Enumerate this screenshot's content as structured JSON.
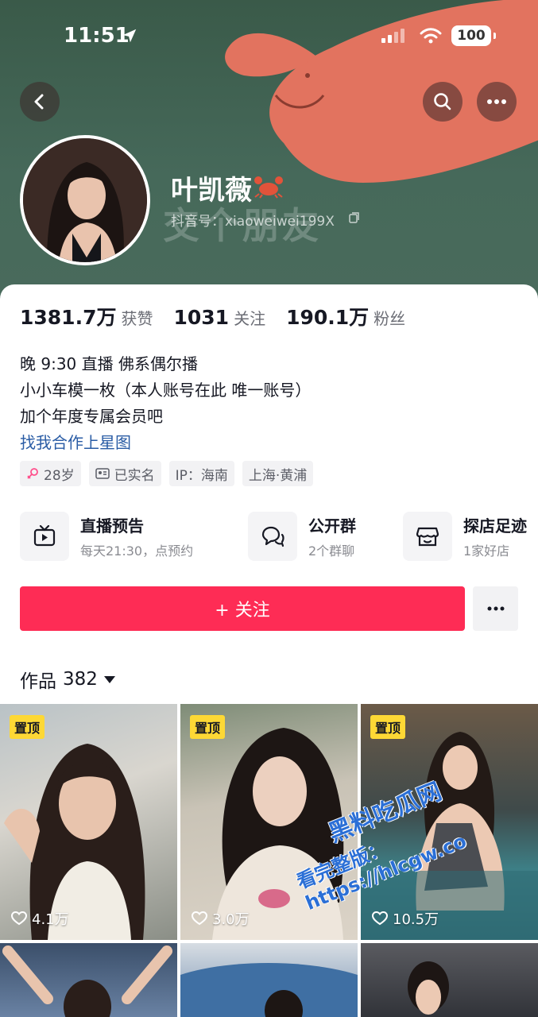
{
  "status_bar": {
    "time": "11:51",
    "battery": "100"
  },
  "profile": {
    "name": "叶凯薇",
    "douyin_id": "抖音号：xiaoweiwei199X",
    "cover_watermark": "交个朋友"
  },
  "stats": [
    {
      "value": "1381.7万",
      "label": "获赞"
    },
    {
      "value": "1031",
      "label": "关注"
    },
    {
      "value": "190.1万",
      "label": "粉丝"
    }
  ],
  "bio": {
    "lines": [
      "晚 9:30 直播 佛系偶尔播",
      "小小车模一枚（本人账号在此 唯一账号）",
      "加个年度专属会员吧"
    ],
    "link": "找我合作上星图"
  },
  "tags": [
    "28岁",
    "已实名",
    "IP：海南",
    "上海·黄浦"
  ],
  "features": [
    {
      "title": "直播预告",
      "subtitle": "每天21:30，点预约",
      "icon": "tv-icon"
    },
    {
      "title": "公开群",
      "subtitle": "2个群聊",
      "icon": "chat-icon"
    },
    {
      "title": "探店足迹",
      "subtitle": "1家好店",
      "icon": "shop-icon"
    }
  ],
  "follow_button": "+ 关注",
  "works": {
    "label": "作品",
    "count": "382"
  },
  "videos": [
    {
      "pinned_label": "置顶",
      "likes": "4.1万"
    },
    {
      "pinned_label": "置顶",
      "likes": "3.0万"
    },
    {
      "pinned_label": "置顶",
      "likes": "10.5万"
    }
  ],
  "site_watermark": {
    "line1": "黑料吃瓜网",
    "line2": "看完整版：https://hlcgw.co"
  },
  "colors": {
    "accent": "#fe2c55",
    "link": "#2a5ca5",
    "cover": "#46695a",
    "pin": "#fdd835"
  }
}
